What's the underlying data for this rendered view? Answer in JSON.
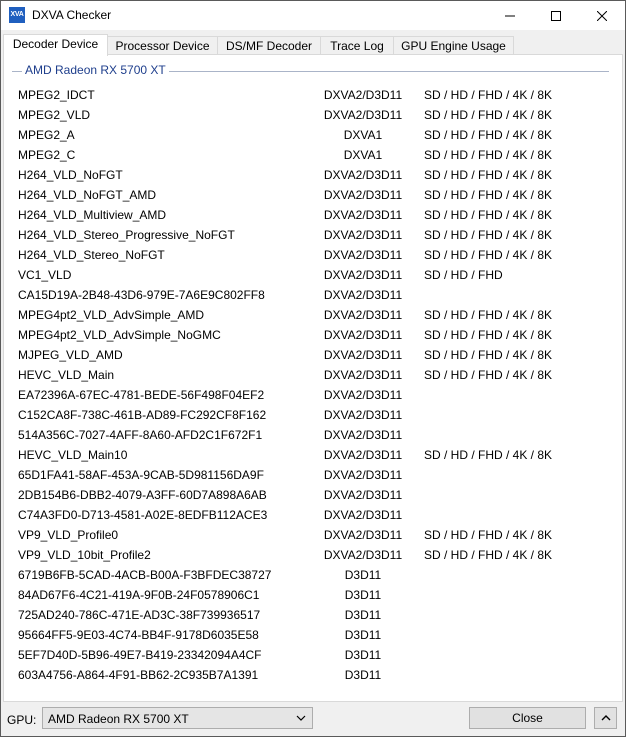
{
  "window": {
    "title": "DXVA Checker",
    "icon_label": "XVA"
  },
  "tabs": [
    {
      "label": "Decoder Device",
      "active": true
    },
    {
      "label": "Processor Device",
      "active": false
    },
    {
      "label": "DS/MF Decoder",
      "active": false
    },
    {
      "label": "Trace Log",
      "active": false
    },
    {
      "label": "GPU Engine Usage",
      "active": false
    }
  ],
  "group": {
    "title": "AMD Radeon RX 5700 XT"
  },
  "decoders": [
    {
      "name": "MPEG2_IDCT",
      "api": "DXVA2/D3D11",
      "res": "SD / HD / FHD / 4K / 8K"
    },
    {
      "name": "MPEG2_VLD",
      "api": "DXVA2/D3D11",
      "res": "SD / HD / FHD / 4K / 8K"
    },
    {
      "name": "MPEG2_A",
      "api": "DXVA1",
      "res": "SD / HD / FHD / 4K / 8K"
    },
    {
      "name": "MPEG2_C",
      "api": "DXVA1",
      "res": "SD / HD / FHD / 4K / 8K"
    },
    {
      "name": "H264_VLD_NoFGT",
      "api": "DXVA2/D3D11",
      "res": "SD / HD / FHD / 4K / 8K"
    },
    {
      "name": "H264_VLD_NoFGT_AMD",
      "api": "DXVA2/D3D11",
      "res": "SD / HD / FHD / 4K / 8K"
    },
    {
      "name": "H264_VLD_Multiview_AMD",
      "api": "DXVA2/D3D11",
      "res": "SD / HD / FHD / 4K / 8K"
    },
    {
      "name": "H264_VLD_Stereo_Progressive_NoFGT",
      "api": "DXVA2/D3D11",
      "res": "SD / HD / FHD / 4K / 8K"
    },
    {
      "name": "H264_VLD_Stereo_NoFGT",
      "api": "DXVA2/D3D11",
      "res": "SD / HD / FHD / 4K / 8K"
    },
    {
      "name": "VC1_VLD",
      "api": "DXVA2/D3D11",
      "res": "SD / HD / FHD"
    },
    {
      "name": "CA15D19A-2B48-43D6-979E-7A6E9C802FF8",
      "api": "DXVA2/D3D11",
      "res": ""
    },
    {
      "name": "MPEG4pt2_VLD_AdvSimple_AMD",
      "api": "DXVA2/D3D11",
      "res": "SD / HD / FHD / 4K / 8K"
    },
    {
      "name": "MPEG4pt2_VLD_AdvSimple_NoGMC",
      "api": "DXVA2/D3D11",
      "res": "SD / HD / FHD / 4K / 8K"
    },
    {
      "name": "MJPEG_VLD_AMD",
      "api": "DXVA2/D3D11",
      "res": "SD / HD / FHD / 4K / 8K"
    },
    {
      "name": "HEVC_VLD_Main",
      "api": "DXVA2/D3D11",
      "res": "SD / HD / FHD / 4K / 8K"
    },
    {
      "name": "EA72396A-67EC-4781-BEDE-56F498F04EF2",
      "api": "DXVA2/D3D11",
      "res": ""
    },
    {
      "name": "C152CA8F-738C-461B-AD89-FC292CF8F162",
      "api": "DXVA2/D3D11",
      "res": ""
    },
    {
      "name": "514A356C-7027-4AFF-8A60-AFD2C1F672F1",
      "api": "DXVA2/D3D11",
      "res": ""
    },
    {
      "name": "HEVC_VLD_Main10",
      "api": "DXVA2/D3D11",
      "res": "SD / HD / FHD / 4K / 8K"
    },
    {
      "name": "65D1FA41-58AF-453A-9CAB-5D981156DA9F",
      "api": "DXVA2/D3D11",
      "res": ""
    },
    {
      "name": "2DB154B6-DBB2-4079-A3FF-60D7A898A6AB",
      "api": "DXVA2/D3D11",
      "res": ""
    },
    {
      "name": "C74A3FD0-D713-4581-A02E-8EDFB112ACE3",
      "api": "DXVA2/D3D11",
      "res": ""
    },
    {
      "name": "VP9_VLD_Profile0",
      "api": "DXVA2/D3D11",
      "res": "SD / HD / FHD / 4K / 8K"
    },
    {
      "name": "VP9_VLD_10bit_Profile2",
      "api": "DXVA2/D3D11",
      "res": "SD / HD / FHD / 4K / 8K"
    },
    {
      "name": "6719B6FB-5CAD-4ACB-B00A-F3BFDEC38727",
      "api": "D3D11",
      "res": ""
    },
    {
      "name": "84AD67F6-4C21-419A-9F0B-24F0578906C1",
      "api": "D3D11",
      "res": ""
    },
    {
      "name": "725AD240-786C-471E-AD3C-38F739936517",
      "api": "D3D11",
      "res": ""
    },
    {
      "name": "95664FF5-9E03-4C74-BB4F-9178D6035E58",
      "api": "D3D11",
      "res": ""
    },
    {
      "name": "5EF7D40D-5B96-49E7-B419-23342094A4CF",
      "api": "D3D11",
      "res": ""
    },
    {
      "name": "603A4756-A864-4F91-BB62-2C935B7A1391",
      "api": "D3D11",
      "res": ""
    }
  ],
  "footer": {
    "gpu_label": "GPU:",
    "gpu_value": "AMD Radeon RX 5700 XT",
    "close_label": "Close"
  },
  "colors": {
    "group_title": "#1e3e8c",
    "app_icon": "#1f5fbf"
  },
  "icons": [
    "app-icon",
    "minimize-icon",
    "maximize-icon",
    "close-icon",
    "chevron-down-icon",
    "chevron-up-icon"
  ]
}
